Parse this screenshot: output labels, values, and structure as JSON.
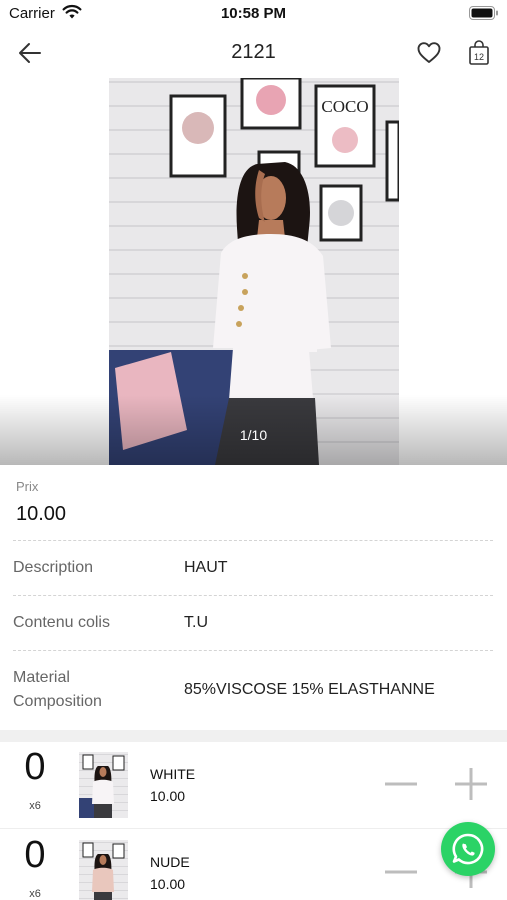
{
  "status_bar": {
    "carrier": "Carrier",
    "time": "10:58 PM",
    "icons": [
      "wifi-icon",
      "battery-icon"
    ]
  },
  "nav": {
    "title": "2121",
    "icons": [
      "back-arrow-icon",
      "heart-icon",
      "shopping-bag-icon"
    ],
    "bag_count": "12"
  },
  "gallery": {
    "pager": "1/10",
    "poster_text": "COCO"
  },
  "product": {
    "price_label": "Prix",
    "price": "10.00",
    "details": [
      {
        "label": "Description",
        "value": "HAUT"
      },
      {
        "label": "Contenu colis",
        "value": "T.U"
      },
      {
        "label": "Material Composition",
        "label_lines": [
          "Material",
          "Composition"
        ],
        "value": "85%VISCOSE 15% ELASTHANNE"
      }
    ]
  },
  "variants": [
    {
      "qty": "0",
      "unit": "x6",
      "name": "WHITE",
      "price": "10.00"
    },
    {
      "qty": "0",
      "unit": "x6",
      "name": "NUDE",
      "price": "10.00"
    }
  ],
  "colors": {
    "whatsapp": "#2bd366",
    "divider": "#d4d4d4",
    "label_gray": "#666666"
  }
}
